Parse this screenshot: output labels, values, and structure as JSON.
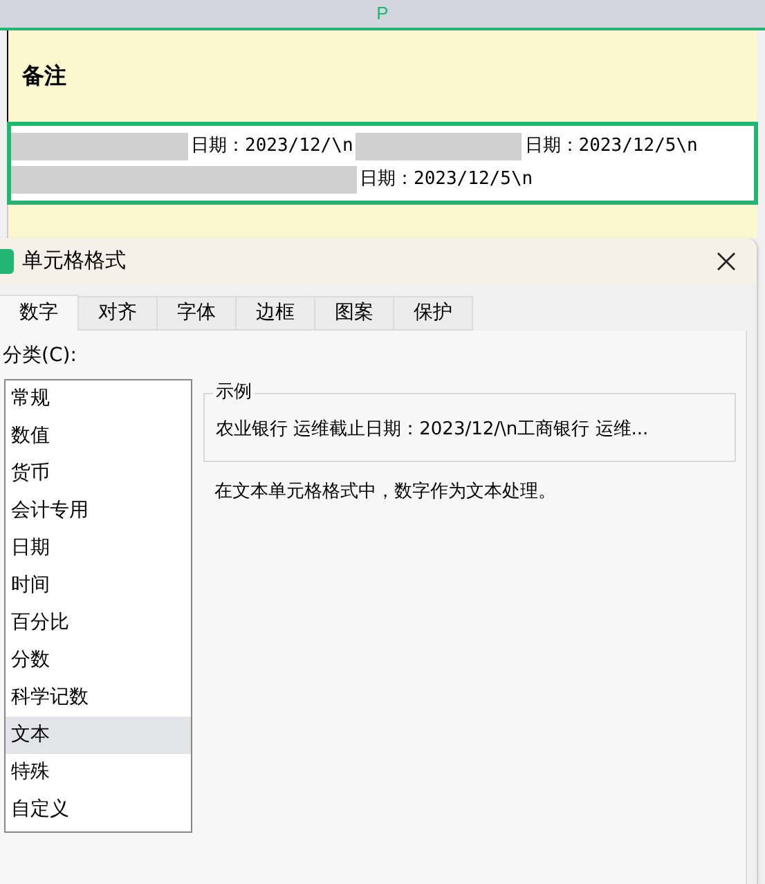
{
  "sheet": {
    "column_header": "P",
    "header_cell": "备注",
    "cell_lines": [
      [
        "日期：2023/12/\\n",
        "日期：2023/12/5\\n"
      ],
      [
        "日期：2023/12/5\\n"
      ]
    ]
  },
  "dialog": {
    "title": "单元格格式",
    "tabs": [
      {
        "label": "数字",
        "selected": true
      },
      {
        "label": "对齐",
        "selected": false
      },
      {
        "label": "字体",
        "selected": false
      },
      {
        "label": "边框",
        "selected": false
      },
      {
        "label": "图案",
        "selected": false
      },
      {
        "label": "保护",
        "selected": false
      }
    ],
    "category_label": "分类(C):",
    "categories": [
      {
        "label": "常规",
        "selected": false
      },
      {
        "label": "数值",
        "selected": false
      },
      {
        "label": "货币",
        "selected": false
      },
      {
        "label": "会计专用",
        "selected": false
      },
      {
        "label": "日期",
        "selected": false
      },
      {
        "label": "时间",
        "selected": false
      },
      {
        "label": "百分比",
        "selected": false
      },
      {
        "label": "分数",
        "selected": false
      },
      {
        "label": "科学记数",
        "selected": false
      },
      {
        "label": "文本",
        "selected": true
      },
      {
        "label": "特殊",
        "selected": false
      },
      {
        "label": "自定义",
        "selected": false
      }
    ],
    "sample_title": "示例",
    "sample_value": "农业银行 运维截止日期：2023/12/\\n工商银行 运维...",
    "description": "在文本单元格格式中，数字作为文本处理。"
  }
}
